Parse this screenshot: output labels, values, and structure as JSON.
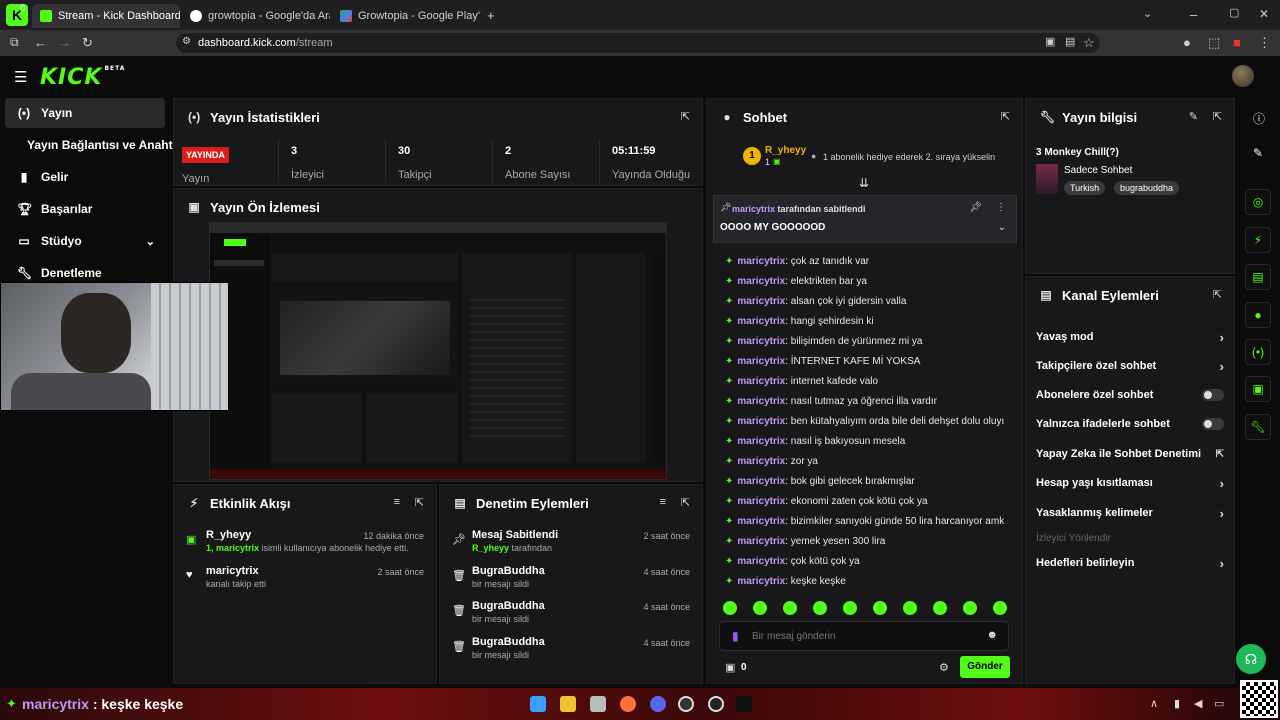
{
  "browser": {
    "tabs": [
      {
        "label": "Stream - Kick Dashboard",
        "active": true
      },
      {
        "label": "growtopia - Google'da Ara",
        "active": false
      },
      {
        "label": "Growtopia - Google Play'de Uyg",
        "active": false
      }
    ],
    "url_domain": "dashboard.kick.com",
    "url_path": "/stream",
    "tab_counter": "0"
  },
  "kick": {
    "logo": "KICK",
    "logo_badge": "BETA"
  },
  "sidebar": {
    "items": [
      {
        "label": "Yayın",
        "icon": "broadcast-icon",
        "active": true
      },
      {
        "label": "Yayın Bağlantısı ve Anahtarı",
        "icon": "",
        "active": false
      },
      {
        "label": "Gelir",
        "icon": "chart-icon",
        "active": false
      },
      {
        "label": "Başarılar",
        "icon": "trophy-icon",
        "active": false
      },
      {
        "label": "Stüdyo",
        "icon": "studio-icon",
        "active": false
      },
      {
        "label": "Denetleme",
        "icon": "wrench-icon",
        "active": false
      }
    ]
  },
  "stats": {
    "title": "Yayın İstatistikleri",
    "live_badge": "YAYINDA",
    "live_label": "Yayın",
    "items": [
      {
        "value": "3",
        "label": "İzleyici"
      },
      {
        "value": "30",
        "label": "Takipçi"
      },
      {
        "value": "2",
        "label": "Abone Sayısı"
      },
      {
        "value": "05:11:59",
        "label": "Yayında Olduğu"
      }
    ]
  },
  "preview": {
    "title": "Yayın Ön İzlemesi"
  },
  "activity": {
    "title": "Etkinlik Akışı",
    "items": [
      {
        "title": "R_yheyy",
        "time": "12 dakika önce",
        "sub_green": "1, maricytrix",
        "sub": " isimli kullanıcıya abonelik hediye etti."
      },
      {
        "title": "maricytrix",
        "time": "2 saat önce",
        "sub_green": "",
        "sub": "kanalı takip etti"
      }
    ]
  },
  "moderation": {
    "title": "Denetim Eylemleri",
    "items": [
      {
        "title": "Mesaj Sabitlendi",
        "time": "2 saat önce",
        "sub_green": "R_yheyy",
        "sub": " tarafından"
      },
      {
        "title": "BugraBuddha",
        "time": "4 saat önce",
        "sub_green": "",
        "sub": "bir mesajı sildi"
      },
      {
        "title": "BugraBuddha",
        "time": "4 saat önce",
        "sub_green": "",
        "sub": "bir mesajı sildi"
      },
      {
        "title": "BugraBuddha",
        "time": "4 saat önce",
        "sub_green": "",
        "sub": "bir mesajı sildi"
      }
    ]
  },
  "chat": {
    "title": "Sohbet",
    "top_gifter": {
      "rank": "1",
      "name": "R_yheyy",
      "count": "1",
      "note": "1 abonelik hediye ederek 2. sıraya yükselin"
    },
    "pinned": {
      "by": "maricytrix",
      "by_suffix": " tarafından sabitlendi",
      "text": "OOOO MY GOOOOOD"
    },
    "messages": [
      {
        "user": "maricytrix",
        "text": "çok az tanıdık var"
      },
      {
        "user": "maricytrix",
        "text": "elektrikten bar ya"
      },
      {
        "user": "maricytrix",
        "text": "alsan çok iyi gidersin valla"
      },
      {
        "user": "maricytrix",
        "text": "hangi şehirdesin ki"
      },
      {
        "user": "maricytrix",
        "text": "bilişimden de yürünmez mi ya"
      },
      {
        "user": "maricytrix",
        "text": "İNTERNET KAFE Mİ YOKSA"
      },
      {
        "user": "maricytrix",
        "text": "internet kafede valo"
      },
      {
        "user": "maricytrix",
        "text": "nasıl tutmaz ya öğrenci illa vardır"
      },
      {
        "user": "maricytrix",
        "text": "ben kütahyalıyım orda bile deli dehşet dolu oluyı"
      },
      {
        "user": "maricytrix",
        "text": "nasıl iş bakıyosun mesela"
      },
      {
        "user": "maricytrix",
        "text": "zor ya"
      },
      {
        "user": "maricytrix",
        "text": "bok gibi gelecek bırakmışlar"
      },
      {
        "user": "maricytrix",
        "text": "ekonomi zaten çok kötü çok ya"
      },
      {
        "user": "maricytrix",
        "text": "bizimkiler sanıyoki günde 50 lira harcanıyor amk"
      },
      {
        "user": "maricytrix",
        "text": "yemek yesen 300 lira"
      },
      {
        "user": "maricytrix",
        "text": "çok kötü çok ya"
      },
      {
        "user": "maricytrix",
        "text": "keşke keşke"
      }
    ],
    "input_placeholder": "Bir mesaj gönderin",
    "points": "0",
    "send_label": "Gönder"
  },
  "stream_info": {
    "title": "Yayın bilgisi",
    "stream_title": "3 Monkey Chill(?)",
    "category": "Sadece Sohbet",
    "tags": [
      "Turkish",
      "bugrabuddha"
    ]
  },
  "channel_actions": {
    "title": "Kanal Eylemleri",
    "items": [
      {
        "label": "Yavaş mod",
        "control": "chevron"
      },
      {
        "label": "Takipçilere özel sohbet",
        "control": "chevron"
      },
      {
        "label": "Abonelere özel sohbet",
        "control": "toggle"
      },
      {
        "label": "Yalnızca ifadelerle sohbet",
        "control": "toggle"
      },
      {
        "label": "Yapay Zeka ile Sohbet Denetimi",
        "control": "external"
      },
      {
        "label": "Hesap yaşı kısıtlaması",
        "control": "chevron"
      },
      {
        "label": "Yasaklanmış kelimeler",
        "control": "chevron"
      },
      {
        "label": "İzleyici Yönlendir",
        "control": "disabled"
      },
      {
        "label": "Hedefleri belirleyin",
        "control": "chevron"
      }
    ]
  },
  "taskbar": {
    "ticker_user": "maricytrix",
    "ticker_text": " : keşke keşke"
  },
  "colors": {
    "accent": "#53fc18",
    "live": "#d81d1d",
    "username": "#bd9af7",
    "panel": "#18181b"
  }
}
